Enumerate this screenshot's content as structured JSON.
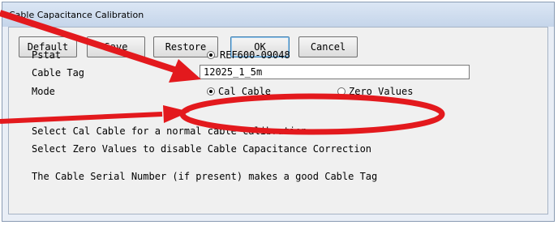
{
  "window": {
    "title": "Cable Capacitance Calibration"
  },
  "toolbar": {
    "default_label": "Default",
    "save_label": "Save",
    "restore_label": "Restore",
    "ok_label": "OK",
    "cancel_label": "Cancel"
  },
  "form": {
    "pstat_label": "Pstat",
    "pstat_value": "REF600-09048",
    "cable_tag_label": "Cable Tag",
    "cable_tag_value": "12025_1_5m",
    "mode_label": "Mode",
    "mode_options": [
      "Cal Cable",
      "Zero Values"
    ],
    "mode_selected": "Cal Cable"
  },
  "help": {
    "line1": "Select Cal Cable for a normal cable calibration",
    "line2": "Select Zero Values to disable Cable Capacitance Correction",
    "line3": "The Cable Serial Number (if present) makes a good Cable Tag"
  },
  "annotation": {
    "color": "#e3191d"
  }
}
